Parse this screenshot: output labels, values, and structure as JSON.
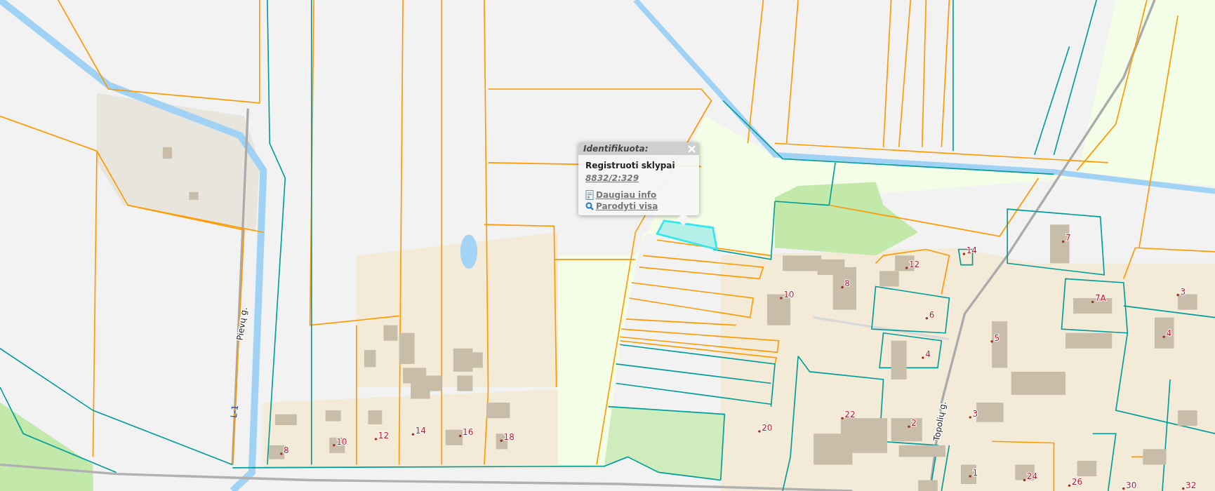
{
  "map": {
    "street_labels": [
      {
        "text": "Pievų g.",
        "kind": "street"
      },
      {
        "text": "L-1",
        "kind": "canal"
      },
      {
        "text": "Topolių g.",
        "kind": "street"
      }
    ],
    "house_numbers": [
      "8",
      "10",
      "12",
      "14",
      "16",
      "18",
      "20",
      "22",
      "2",
      "3",
      "1",
      "24",
      "26",
      "30",
      "32",
      "10",
      "8",
      "12",
      "6",
      "4",
      "5",
      "14",
      "7",
      "7A",
      "3",
      "4"
    ]
  },
  "popup": {
    "title": "Identifikuota:",
    "layer": "Registruoti sklypai",
    "parcel_id": "8832/2:329",
    "links": [
      {
        "label": "Daugiau info",
        "kind": "info"
      },
      {
        "label": "Parodyti visa",
        "kind": "zoom"
      }
    ]
  }
}
